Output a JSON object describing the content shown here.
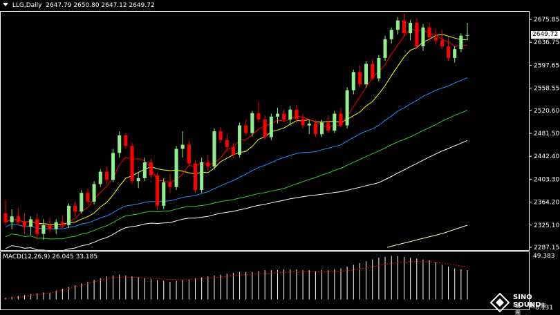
{
  "header": {
    "symbol": "LLG,Daily",
    "ohlc": "2647.79 2650.80 2647.12 2649.72"
  },
  "last_price": "2649.72",
  "macd": {
    "label": "MACD(12,26,9) 26.045 33.185",
    "axis_top": "49.383",
    "axis_bottom": "-8.131"
  },
  "logo": {
    "text": "SINO SOUND",
    "sub": "漢 聲 集 團"
  },
  "colors": {
    "up": "#90ee90",
    "down": "#ff0000",
    "ma5": "#ff0000",
    "ma10": "#ffff00",
    "ma_blue": "#1e90ff",
    "ma_green": "#32cd32",
    "ma_white": "#ffffff",
    "ma_long": "#ffffcc",
    "signal": "#ff0000"
  },
  "chart_data": {
    "type": "candlestick",
    "y_ticks": [
      "2675.85",
      "2636.75",
      "2597.65",
      "2558.55",
      "2520.60",
      "2481.50",
      "2442.40",
      "2403.30",
      "2364.20",
      "2325.10",
      "2287.15"
    ],
    "ylim": [
      2287.15,
      2675.85
    ],
    "candles": [
      [
        2345,
        2368,
        2325,
        2330
      ],
      [
        2330,
        2352,
        2318,
        2340
      ],
      [
        2340,
        2355,
        2325,
        2330
      ],
      [
        2330,
        2345,
        2310,
        2322
      ],
      [
        2322,
        2340,
        2308,
        2335
      ],
      [
        2335,
        2345,
        2300,
        2310
      ],
      [
        2310,
        2335,
        2300,
        2325
      ],
      [
        2325,
        2338,
        2312,
        2318
      ],
      [
        2318,
        2335,
        2310,
        2330
      ],
      [
        2330,
        2342,
        2320,
        2325
      ],
      [
        2325,
        2362,
        2320,
        2358
      ],
      [
        2358,
        2365,
        2340,
        2348
      ],
      [
        2348,
        2385,
        2345,
        2380
      ],
      [
        2380,
        2388,
        2360,
        2365
      ],
      [
        2365,
        2400,
        2360,
        2395
      ],
      [
        2395,
        2420,
        2390,
        2416
      ],
      [
        2416,
        2425,
        2395,
        2402
      ],
      [
        2402,
        2455,
        2398,
        2448
      ],
      [
        2448,
        2485,
        2440,
        2478
      ],
      [
        2478,
        2482,
        2455,
        2460
      ],
      [
        2460,
        2465,
        2395,
        2400
      ],
      [
        2400,
        2415,
        2388,
        2405
      ],
      [
        2405,
        2440,
        2400,
        2432
      ],
      [
        2432,
        2438,
        2405,
        2410
      ],
      [
        2410,
        2415,
        2350,
        2358
      ],
      [
        2358,
        2405,
        2352,
        2398
      ],
      [
        2398,
        2412,
        2380,
        2390
      ],
      [
        2390,
        2460,
        2385,
        2455
      ],
      [
        2455,
        2485,
        2440,
        2462
      ],
      [
        2462,
        2470,
        2425,
        2430
      ],
      [
        2430,
        2435,
        2380,
        2385
      ],
      [
        2385,
        2440,
        2380,
        2432
      ],
      [
        2432,
        2445,
        2418,
        2425
      ],
      [
        2425,
        2490,
        2420,
        2485
      ],
      [
        2485,
        2492,
        2465,
        2470
      ],
      [
        2470,
        2480,
        2450,
        2458
      ],
      [
        2458,
        2465,
        2440,
        2445
      ],
      [
        2445,
        2500,
        2440,
        2495
      ],
      [
        2495,
        2505,
        2478,
        2482
      ],
      [
        2482,
        2520,
        2476,
        2516
      ],
      [
        2516,
        2535,
        2500,
        2505
      ],
      [
        2505,
        2512,
        2470,
        2475
      ],
      [
        2475,
        2515,
        2470,
        2510
      ],
      [
        2510,
        2525,
        2498,
        2515
      ],
      [
        2515,
        2522,
        2500,
        2505
      ],
      [
        2505,
        2528,
        2495,
        2522
      ],
      [
        2522,
        2530,
        2500,
        2506
      ],
      [
        2506,
        2515,
        2490,
        2495
      ],
      [
        2495,
        2505,
        2480,
        2498
      ],
      [
        2498,
        2505,
        2475,
        2480
      ],
      [
        2480,
        2505,
        2475,
        2500
      ],
      [
        2500,
        2512,
        2482,
        2486
      ],
      [
        2486,
        2520,
        2482,
        2515
      ],
      [
        2515,
        2525,
        2492,
        2495
      ],
      [
        2495,
        2560,
        2490,
        2555
      ],
      [
        2555,
        2590,
        2548,
        2586
      ],
      [
        2586,
        2598,
        2560,
        2565
      ],
      [
        2565,
        2605,
        2560,
        2600
      ],
      [
        2600,
        2608,
        2572,
        2575
      ],
      [
        2575,
        2615,
        2570,
        2610
      ],
      [
        2610,
        2648,
        2605,
        2642
      ],
      [
        2642,
        2662,
        2635,
        2658
      ],
      [
        2658,
        2680,
        2650,
        2674
      ],
      [
        2674,
        2685,
        2648,
        2652
      ],
      [
        2652,
        2675,
        2640,
        2670
      ],
      [
        2670,
        2678,
        2625,
        2630
      ],
      [
        2630,
        2668,
        2622,
        2662
      ],
      [
        2662,
        2670,
        2640,
        2645
      ],
      [
        2645,
        2660,
        2632,
        2640
      ],
      [
        2640,
        2658,
        2625,
        2630
      ],
      [
        2630,
        2645,
        2605,
        2610
      ],
      [
        2610,
        2630,
        2602,
        2625
      ],
      [
        2625,
        2652,
        2620,
        2648
      ],
      [
        2648,
        2670,
        2640,
        2649
      ]
    ],
    "macd_hist": [
      2,
      3,
      4,
      5,
      6,
      7,
      8,
      8,
      10,
      12,
      14,
      16,
      18,
      20,
      22,
      24,
      26,
      27,
      28,
      27,
      26,
      25,
      24,
      23,
      22,
      21,
      20,
      21,
      22,
      23,
      24,
      25,
      26,
      27,
      28,
      29,
      30,
      31,
      31,
      31,
      32,
      33,
      33,
      33,
      34,
      34,
      34,
      33,
      33,
      32,
      33,
      33,
      34,
      35,
      37,
      39,
      41,
      43,
      45,
      47,
      48,
      49,
      49,
      48,
      47,
      46,
      45,
      44,
      42,
      39,
      37,
      35,
      34,
      33
    ],
    "macd_signal": [
      1,
      1.5,
      2.5,
      3.5,
      4.5,
      5.5,
      6.5,
      7.5,
      9,
      10.5,
      12,
      14,
      16,
      18,
      20,
      22,
      23.5,
      24.5,
      25,
      25.2,
      25,
      24.7,
      24.3,
      23.8,
      23.3,
      22.8,
      22.5,
      22.3,
      22.4,
      22.6,
      23,
      23.5,
      24,
      24.6,
      25.2,
      25.9,
      26.6,
      27.4,
      28,
      28.5,
      29,
      29.4,
      29.8,
      30.2,
      30.6,
      31,
      31.2,
      31.3,
      31.3,
      31.2,
      31.2,
      31.3,
      31.5,
      31.9,
      32.5,
      33.3,
      34.3,
      35.5,
      36.8,
      38.2,
      39.5,
      40.6,
      41.5,
      42.1,
      42.5,
      42.6,
      42.5,
      42.2,
      41.7,
      40.9,
      39.9,
      38.8,
      37.6,
      36.5
    ],
    "macd_ylim": [
      -8.131,
      49.383
    ]
  }
}
